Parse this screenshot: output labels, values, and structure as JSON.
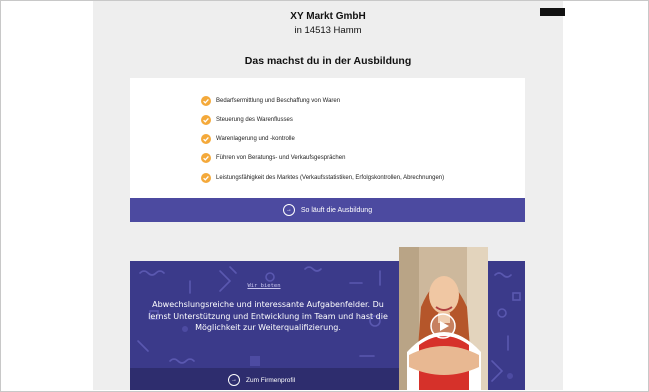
{
  "company": {
    "name": "XY Markt GmbH",
    "city": "in 14513 Hamm"
  },
  "training": {
    "title": "Das machst du in der Ausbildung",
    "tasks": [
      "Bedarfsermittlung und Beschaffung von Waren",
      "Steuerung des Warenflusses",
      "Warenlagerung und -kontrolle",
      "Führen von Beratungs- und Verkaufsgesprächen",
      "Leistungsfähigkeit des Marktes (Verkaufsstatistiken, Erfolgskontrollen, Abrechnungen)"
    ],
    "button_label": "So läuft die Ausbildung"
  },
  "offer": {
    "kicker": "Wir bieten",
    "text": "Abwechslungsreiche und interessante Aufgabenfelder. Du lernst Unterstützung und Entwicklung im Team und hast die Möglichkeit zur Weiterqualifizierung.",
    "button_label": "Zum Firmenprofil"
  },
  "colors": {
    "accent_purple": "#4c4aa0",
    "promo_purple": "#3b3a8a",
    "check_orange": "#f4a93a",
    "page_gray": "#eeeeee"
  },
  "icons": {
    "task_bullet": "check-circle-icon",
    "button_arrow": "arrow-circle-icon",
    "video": "play-icon"
  }
}
